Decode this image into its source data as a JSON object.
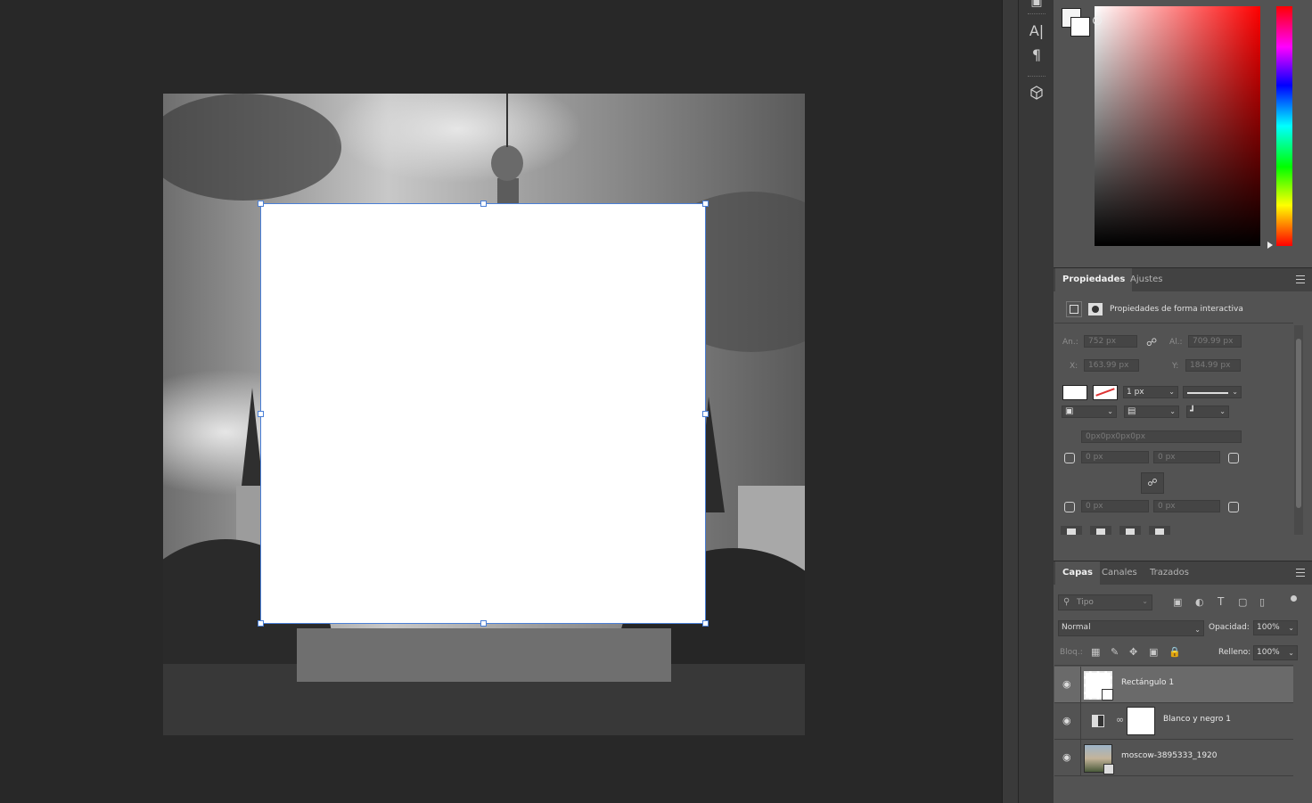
{
  "toolbar": {
    "icons": [
      "move-icon",
      "type-icon",
      "paragraph-icon",
      "3d-cube-icon"
    ],
    "type_glyph": "A|",
    "paragraph_glyph": "¶"
  },
  "color_panel": {
    "foreground": "#f5f5f5",
    "background": "#ffffff"
  },
  "properties": {
    "tabs": [
      "Propiedades",
      "Ajustes"
    ],
    "header_label": "Propiedades de forma interactiva",
    "width_label": "An.:",
    "width_value": "752 px",
    "height_label": "Al.:",
    "height_value": "709.99 px",
    "x_label": "X:",
    "x_value": "163.99 px",
    "y_label": "Y:",
    "y_value": "184.99 px",
    "stroke_size": "1 px",
    "radius_summary": "0px0px0px0px",
    "radius_tl": "0 px",
    "radius_tr": "0 px",
    "radius_bl": "0 px",
    "radius_br": "0 px"
  },
  "layers": {
    "tabs": [
      "Capas",
      "Canales",
      "Trazados"
    ],
    "filter_placeholder": "Tipo",
    "blend_mode": "Normal",
    "opacity_label": "Opacidad:",
    "opacity_value": "100%",
    "lock_label": "Bloq.:",
    "fill_label": "Relleno:",
    "fill_value": "100%",
    "items": [
      {
        "name": "Rectángulo 1",
        "visible": true,
        "selected": true
      },
      {
        "name": "Blanco y negro 1",
        "visible": true,
        "selected": false
      },
      {
        "name": "moscow-3895333_1920",
        "visible": true,
        "selected": false
      }
    ]
  }
}
